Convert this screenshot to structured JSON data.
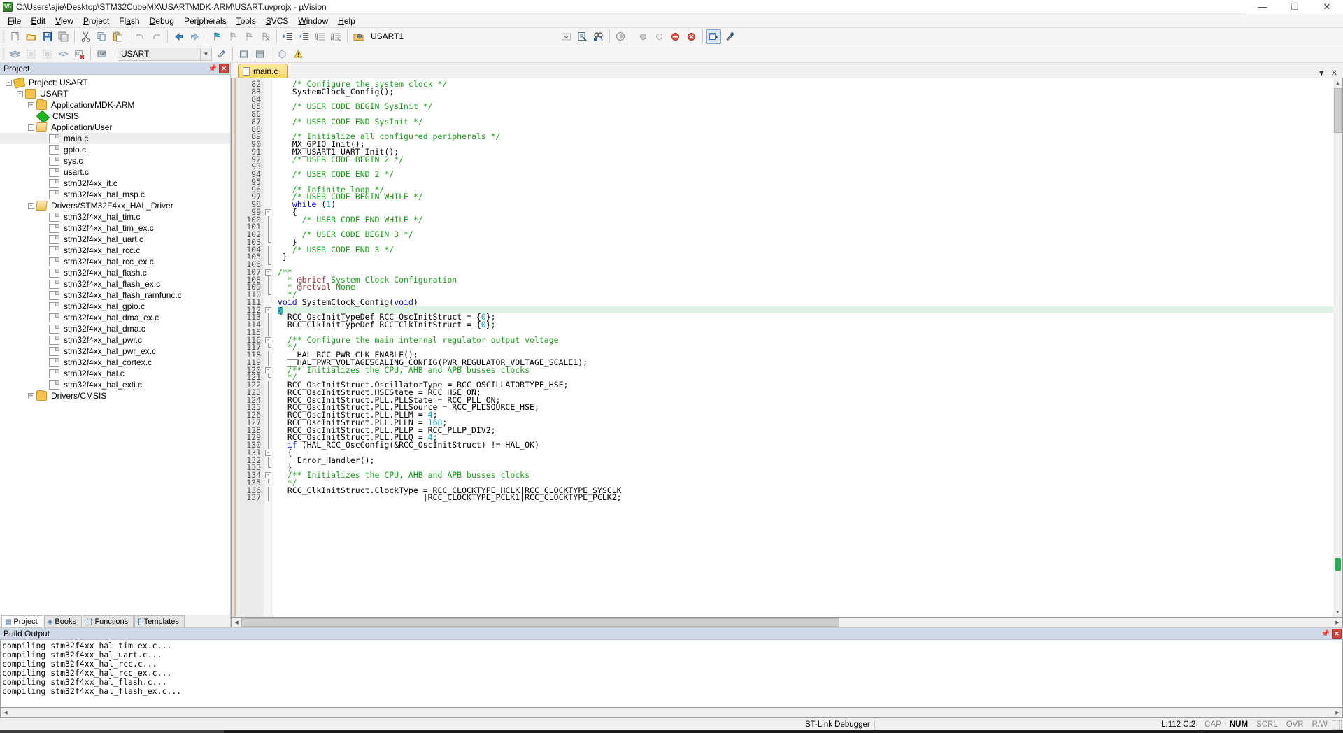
{
  "window": {
    "title": "C:\\Users\\ajie\\Desktop\\STM32CubeMX\\USART\\MDK-ARM\\USART.uvprojx - µVision",
    "app_icon": "uvision-logo-icon",
    "minimize": "—",
    "maximize": "❐",
    "close": "✕"
  },
  "menubar": {
    "items": [
      {
        "label": "File",
        "accel": "F"
      },
      {
        "label": "Edit",
        "accel": "E"
      },
      {
        "label": "View",
        "accel": "V"
      },
      {
        "label": "Project",
        "accel": "P"
      },
      {
        "label": "Flash",
        "accel": "a"
      },
      {
        "label": "Debug",
        "accel": "D"
      },
      {
        "label": "Peripherals",
        "accel": "i"
      },
      {
        "label": "Tools",
        "accel": "T"
      },
      {
        "label": "SVCS",
        "accel": "S"
      },
      {
        "label": "Window",
        "accel": "W"
      },
      {
        "label": "Help",
        "accel": "H"
      }
    ]
  },
  "toolbar_main": {
    "buttons": [
      "new-file-icon",
      "open-file-icon",
      "save-icon",
      "save-all-icon",
      "cut-icon",
      "copy-icon",
      "paste-icon",
      "undo-icon",
      "redo-icon",
      "navigate-back-icon",
      "navigate-forward-icon",
      "bookmark-toggle-icon",
      "bookmark-prev-icon",
      "bookmark-next-icon",
      "bookmark-clear-icon",
      "indent-icon",
      "outdent-icon",
      "comment-icon",
      "uncomment-icon"
    ],
    "target_icon": "target-options-icon",
    "target_name": "USART1",
    "right_buttons": [
      "dropdown-arrow-icon",
      "find-in-files-icon",
      "search-icon",
      "magnifier-icon",
      "circle-icon",
      "circle-outline-icon",
      "no-entry-icon",
      "stop-icon",
      "window-layout-icon",
      "configure-icon"
    ]
  },
  "toolbar_build": {
    "buttons": [
      "build-file-icon",
      "build-target-icon",
      "rebuild-all-icon",
      "batch-build-icon",
      "stop-build-icon",
      "download-icon"
    ],
    "project_target": "USART",
    "extra_buttons": [
      "target-options-icon",
      "manage-runtime-icon",
      "pack-installer-icon",
      "cubemx-icon",
      "svcs-icon"
    ]
  },
  "project_panel": {
    "header": "Project",
    "pin_icon": "pin-icon",
    "close_icon": "close-icon",
    "tree": [
      {
        "depth": 0,
        "label": "Project: USART",
        "icon": "project-icon",
        "expander": "-",
        "selected": false
      },
      {
        "depth": 1,
        "label": "USART",
        "icon": "target-icon",
        "expander": "-",
        "selected": false
      },
      {
        "depth": 2,
        "label": "Application/MDK-ARM",
        "icon": "folder-icon",
        "expander": "+",
        "selected": false
      },
      {
        "depth": 2,
        "label": "CMSIS",
        "icon": "cmsis-icon",
        "expander": "",
        "selected": false
      },
      {
        "depth": 2,
        "label": "Application/User",
        "icon": "folder-open-icon",
        "expander": "-",
        "selected": false
      },
      {
        "depth": 3,
        "label": "main.c",
        "icon": "file-icon",
        "expander": "",
        "selected": true
      },
      {
        "depth": 3,
        "label": "gpio.c",
        "icon": "file-icon",
        "expander": "",
        "selected": false
      },
      {
        "depth": 3,
        "label": "sys.c",
        "icon": "file-icon",
        "expander": "",
        "selected": false
      },
      {
        "depth": 3,
        "label": "usart.c",
        "icon": "file-icon",
        "expander": "",
        "selected": false
      },
      {
        "depth": 3,
        "label": "stm32f4xx_it.c",
        "icon": "file-icon",
        "expander": "",
        "selected": false
      },
      {
        "depth": 3,
        "label": "stm32f4xx_hal_msp.c",
        "icon": "file-icon",
        "expander": "",
        "selected": false
      },
      {
        "depth": 2,
        "label": "Drivers/STM32F4xx_HAL_Driver",
        "icon": "folder-open-icon",
        "expander": "-",
        "selected": false
      },
      {
        "depth": 3,
        "label": "stm32f4xx_hal_tim.c",
        "icon": "file-icon",
        "expander": "",
        "selected": false
      },
      {
        "depth": 3,
        "label": "stm32f4xx_hal_tim_ex.c",
        "icon": "file-icon",
        "expander": "",
        "selected": false
      },
      {
        "depth": 3,
        "label": "stm32f4xx_hal_uart.c",
        "icon": "file-icon",
        "expander": "",
        "selected": false
      },
      {
        "depth": 3,
        "label": "stm32f4xx_hal_rcc.c",
        "icon": "file-icon",
        "expander": "",
        "selected": false
      },
      {
        "depth": 3,
        "label": "stm32f4xx_hal_rcc_ex.c",
        "icon": "file-icon",
        "expander": "",
        "selected": false
      },
      {
        "depth": 3,
        "label": "stm32f4xx_hal_flash.c",
        "icon": "file-icon",
        "expander": "",
        "selected": false
      },
      {
        "depth": 3,
        "label": "stm32f4xx_hal_flash_ex.c",
        "icon": "file-icon",
        "expander": "",
        "selected": false
      },
      {
        "depth": 3,
        "label": "stm32f4xx_hal_flash_ramfunc.c",
        "icon": "file-icon",
        "expander": "",
        "selected": false
      },
      {
        "depth": 3,
        "label": "stm32f4xx_hal_gpio.c",
        "icon": "file-icon",
        "expander": "",
        "selected": false
      },
      {
        "depth": 3,
        "label": "stm32f4xx_hal_dma_ex.c",
        "icon": "file-icon",
        "expander": "",
        "selected": false
      },
      {
        "depth": 3,
        "label": "stm32f4xx_hal_dma.c",
        "icon": "file-icon",
        "expander": "",
        "selected": false
      },
      {
        "depth": 3,
        "label": "stm32f4xx_hal_pwr.c",
        "icon": "file-icon",
        "expander": "",
        "selected": false
      },
      {
        "depth": 3,
        "label": "stm32f4xx_hal_pwr_ex.c",
        "icon": "file-icon",
        "expander": "",
        "selected": false
      },
      {
        "depth": 3,
        "label": "stm32f4xx_hal_cortex.c",
        "icon": "file-icon",
        "expander": "",
        "selected": false
      },
      {
        "depth": 3,
        "label": "stm32f4xx_hal.c",
        "icon": "file-icon",
        "expander": "",
        "selected": false
      },
      {
        "depth": 3,
        "label": "stm32f4xx_hal_exti.c",
        "icon": "file-icon",
        "expander": "",
        "selected": false
      },
      {
        "depth": 2,
        "label": "Drivers/CMSIS",
        "icon": "folder-icon",
        "expander": "+",
        "selected": false
      }
    ],
    "tabs": [
      {
        "label": "Project",
        "icon": "project-tab-icon",
        "active": true
      },
      {
        "label": "Books",
        "icon": "books-tab-icon",
        "active": false
      },
      {
        "label": "Functions",
        "icon": "functions-tab-icon",
        "active": false
      },
      {
        "label": "Templates",
        "icon": "templates-tab-icon",
        "active": false
      }
    ]
  },
  "editor": {
    "tabs": [
      {
        "label": "main.c",
        "icon": "c-file-icon",
        "active": true
      }
    ],
    "tab_controls": [
      "▼",
      "✕"
    ],
    "first_line": 82,
    "cursor_line": 112,
    "lines": [
      {
        "n": 82,
        "fold": "",
        "text": "   /* Configure the system clock */",
        "cls": "cm"
      },
      {
        "n": 83,
        "fold": "",
        "text": "   SystemClock_Config();",
        "cls": ""
      },
      {
        "n": 84,
        "fold": "",
        "text": "",
        "cls": ""
      },
      {
        "n": 85,
        "fold": "",
        "text": "   /* USER CODE BEGIN SysInit */",
        "cls": "cm"
      },
      {
        "n": 86,
        "fold": "",
        "text": "",
        "cls": ""
      },
      {
        "n": 87,
        "fold": "",
        "text": "   /* USER CODE END SysInit */",
        "cls": "cm"
      },
      {
        "n": 88,
        "fold": "",
        "text": "",
        "cls": ""
      },
      {
        "n": 89,
        "fold": "",
        "text": "   /* Initialize all configured peripherals */",
        "cls": "cm"
      },
      {
        "n": 90,
        "fold": "",
        "text": "   MX_GPIO_Init();",
        "cls": ""
      },
      {
        "n": 91,
        "fold": "",
        "text": "   MX_USART1_UART_Init();",
        "cls": ""
      },
      {
        "n": 92,
        "fold": "",
        "text": "   /* USER CODE BEGIN 2 */",
        "cls": "cm"
      },
      {
        "n": 93,
        "fold": "",
        "text": "",
        "cls": ""
      },
      {
        "n": 94,
        "fold": "",
        "text": "   /* USER CODE END 2 */",
        "cls": "cm"
      },
      {
        "n": 95,
        "fold": "",
        "text": "",
        "cls": ""
      },
      {
        "n": 96,
        "fold": "",
        "text": "   /* Infinite loop */",
        "cls": "cm"
      },
      {
        "n": 97,
        "fold": "",
        "text": "   /* USER CODE BEGIN WHILE */",
        "cls": "cm"
      },
      {
        "n": 98,
        "fold": "",
        "text": "   while (1)",
        "cls": "kwline"
      },
      {
        "n": 99,
        "fold": "-",
        "text": "   {",
        "cls": ""
      },
      {
        "n": 100,
        "fold": "|",
        "text": "     /* USER CODE END WHILE */",
        "cls": "cm"
      },
      {
        "n": 101,
        "fold": "|",
        "text": "",
        "cls": ""
      },
      {
        "n": 102,
        "fold": "|",
        "text": "     /* USER CODE BEGIN 3 */",
        "cls": "cm"
      },
      {
        "n": 103,
        "fold": "L",
        "text": "   }",
        "cls": ""
      },
      {
        "n": 104,
        "fold": "|",
        "text": "   /* USER CODE END 3 */",
        "cls": "cm"
      },
      {
        "n": 105,
        "fold": "|",
        "text": " }",
        "cls": ""
      },
      {
        "n": 106,
        "fold": "L",
        "text": "",
        "cls": ""
      },
      {
        "n": 107,
        "fold": "-",
        "text": "/**",
        "cls": "cm"
      },
      {
        "n": 108,
        "fold": "|",
        "text": "  * @brief System Clock Configuration",
        "cls": "dox-brief"
      },
      {
        "n": 109,
        "fold": "|",
        "text": "  * @retval None",
        "cls": "dox-retval"
      },
      {
        "n": 110,
        "fold": "L",
        "text": "  */",
        "cls": "cm"
      },
      {
        "n": 111,
        "fold": "",
        "text": "void SystemClock_Config(void)",
        "cls": "fndecl"
      },
      {
        "n": 112,
        "fold": "-",
        "text": "{",
        "cls": "cursorline"
      },
      {
        "n": 113,
        "fold": "|",
        "text": "  RCC_OscInitTypeDef RCC_OscInitStruct = {0};",
        "cls": "zerobrace"
      },
      {
        "n": 114,
        "fold": "|",
        "text": "  RCC_ClkInitTypeDef RCC_ClkInitStruct = {0};",
        "cls": "zerobrace"
      },
      {
        "n": 115,
        "fold": "|",
        "text": "",
        "cls": ""
      },
      {
        "n": 116,
        "fold": "-",
        "text": "  /** Configure the main internal regulator output voltage",
        "cls": "cm"
      },
      {
        "n": 117,
        "fold": "L",
        "text": "  */",
        "cls": "cm"
      },
      {
        "n": 118,
        "fold": "|",
        "text": "  __HAL_RCC_PWR_CLK_ENABLE();",
        "cls": ""
      },
      {
        "n": 119,
        "fold": "|",
        "text": "  __HAL_PWR_VOLTAGESCALING_CONFIG(PWR_REGULATOR_VOLTAGE_SCALE1);",
        "cls": ""
      },
      {
        "n": 120,
        "fold": "-",
        "text": "  /** Initializes the CPU, AHB and APB busses clocks",
        "cls": "cm"
      },
      {
        "n": 121,
        "fold": "L",
        "text": "  */",
        "cls": "cm"
      },
      {
        "n": 122,
        "fold": "|",
        "text": "  RCC_OscInitStruct.OscillatorType = RCC_OSCILLATORTYPE_HSE;",
        "cls": ""
      },
      {
        "n": 123,
        "fold": "|",
        "text": "  RCC_OscInitStruct.HSEState = RCC_HSE_ON;",
        "cls": ""
      },
      {
        "n": 124,
        "fold": "|",
        "text": "  RCC_OscInitStruct.PLL.PLLState = RCC_PLL_ON;",
        "cls": ""
      },
      {
        "n": 125,
        "fold": "|",
        "text": "  RCC_OscInitStruct.PLL.PLLSource = RCC_PLLSOURCE_HSE;",
        "cls": ""
      },
      {
        "n": 126,
        "fold": "|",
        "text": "  RCC_OscInitStruct.PLL.PLLM = 4;",
        "cls": "numtail"
      },
      {
        "n": 127,
        "fold": "|",
        "text": "  RCC_OscInitStruct.PLL.PLLN = 168;",
        "cls": "numtail"
      },
      {
        "n": 128,
        "fold": "|",
        "text": "  RCC_OscInitStruct.PLL.PLLP = RCC_PLLP_DIV2;",
        "cls": ""
      },
      {
        "n": 129,
        "fold": "|",
        "text": "  RCC_OscInitStruct.PLL.PLLQ = 4;",
        "cls": "numtail"
      },
      {
        "n": 130,
        "fold": "|",
        "text": "  if (HAL_RCC_OscConfig(&RCC_OscInitStruct) != HAL_OK)",
        "cls": "ifline"
      },
      {
        "n": 131,
        "fold": "-",
        "text": "  {",
        "cls": ""
      },
      {
        "n": 132,
        "fold": "|",
        "text": "    Error_Handler();",
        "cls": ""
      },
      {
        "n": 133,
        "fold": "L",
        "text": "  }",
        "cls": ""
      },
      {
        "n": 134,
        "fold": "-",
        "text": "  /** Initializes the CPU, AHB and APB busses clocks",
        "cls": "cm"
      },
      {
        "n": 135,
        "fold": "L",
        "text": "  */",
        "cls": "cm"
      },
      {
        "n": 136,
        "fold": "|",
        "text": "  RCC_ClkInitStruct.ClockType = RCC_CLOCKTYPE_HCLK|RCC_CLOCKTYPE_SYSCLK",
        "cls": ""
      },
      {
        "n": 137,
        "fold": "|",
        "text": "                              |RCC_CLOCKTYPE_PCLK1|RCC_CLOCKTYPE_PCLK2;",
        "cls": ""
      }
    ]
  },
  "build_output": {
    "header": "Build Output",
    "pin_icon": "pin-icon",
    "close_icon": "close-icon",
    "lines": [
      "compiling stm32f4xx_hal_tim_ex.c...",
      "compiling stm32f4xx_hal_uart.c...",
      "compiling stm32f4xx_hal_rcc.c...",
      "compiling stm32f4xx_hal_rcc_ex.c...",
      "compiling stm32f4xx_hal_flash.c...",
      "compiling stm32f4xx_hal_flash_ex.c..."
    ]
  },
  "statusbar": {
    "debugger": "ST-Link Debugger",
    "position": "L:112 C:2",
    "indicators": [
      "CAP",
      "NUM",
      "SCRL",
      "OVR",
      "R/W"
    ],
    "active_indicators": [
      "NUM"
    ]
  },
  "colors": {
    "comment_green": "#1a9c1a",
    "keyword_blue": "#0000d0",
    "number_cyan": "#0aa0c8",
    "doxygen_red": "#8a3030",
    "cursor_line_bg": "#ddf2e2",
    "cursor_cyan": "#00c5d8",
    "panel_header_blue": "#cfd9e8",
    "tab_yellow": "#fbd36b"
  }
}
